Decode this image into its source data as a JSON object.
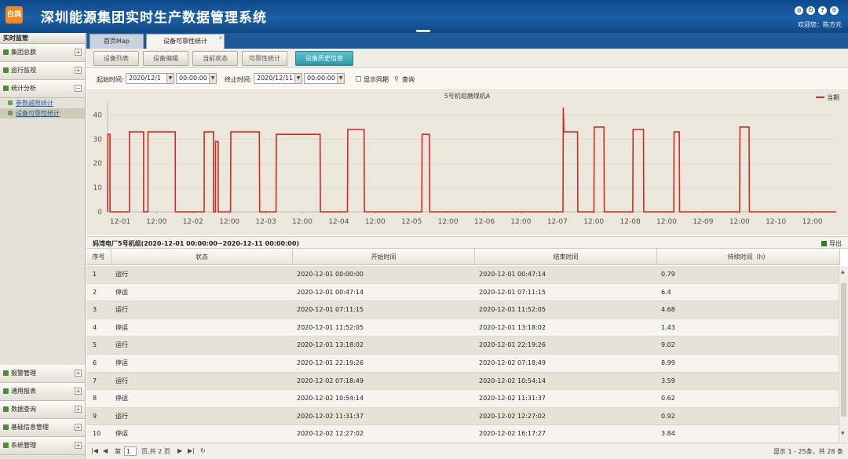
{
  "header": {
    "logo_text": "白鸽",
    "title": "深圳能源集团实时生产数据管理系统",
    "welcome": "欢迎您：陈方元",
    "icons": [
      "globe-icon",
      "power-icon",
      "help-icon",
      "settings-icon"
    ]
  },
  "sidebar": {
    "title": "实时监管",
    "top_sections": [
      {
        "label": "集团总貌",
        "toggle": "+"
      },
      {
        "label": "运行监视",
        "toggle": "+"
      },
      {
        "label": "统计分析",
        "toggle": "−"
      }
    ],
    "sub_items": [
      {
        "label": "参数越限统计"
      },
      {
        "label": "设备可靠性统计"
      }
    ],
    "bottom_sections": [
      {
        "label": "报警管理",
        "toggle": "+"
      },
      {
        "label": "通用报表",
        "toggle": "+"
      },
      {
        "label": "数据查询",
        "toggle": "+"
      },
      {
        "label": "基础信息管理",
        "toggle": "+"
      },
      {
        "label": "系统管理",
        "toggle": "+"
      }
    ]
  },
  "tabs": {
    "map": "首页Map",
    "stat": "设备可靠性统计",
    "close": "x"
  },
  "subtabs": [
    "设备列表",
    "设备编辑",
    "当前状态",
    "可靠性统计",
    "设备历史信息"
  ],
  "filter": {
    "start_label": "起始时间:",
    "start_date": "2020/12/1",
    "start_time": "00:00:00",
    "end_label": "终止时间:",
    "end_date": "2020/12/11",
    "end_time": "00:00:00",
    "show_sync": "显示同期",
    "query": "查询"
  },
  "chart_data": {
    "type": "line",
    "title": "5号机组磨煤机A",
    "legend": "当期",
    "color": "#d22b1f",
    "ylim": [
      0,
      45
    ],
    "yticks": [
      0,
      10,
      20,
      30,
      40
    ],
    "xticks": [
      "12-01",
      "12:00",
      "12-02",
      "12:00",
      "12-03",
      "12:00",
      "12-04",
      "12:00",
      "12-05",
      "12:00",
      "12-06",
      "12:00",
      "12-07",
      "12:00",
      "12-08",
      "12:00",
      "12-09",
      "12:00",
      "12-10",
      "12:00"
    ],
    "xlim_hours": [
      0,
      240
    ],
    "points": [
      [
        0,
        0
      ],
      [
        0.1,
        32
      ],
      [
        0.79,
        32
      ],
      [
        0.8,
        0
      ],
      [
        7.19,
        0
      ],
      [
        7.2,
        33
      ],
      [
        11.86,
        33
      ],
      [
        11.87,
        0
      ],
      [
        13.3,
        0
      ],
      [
        13.31,
        33
      ],
      [
        22.3,
        33
      ],
      [
        22.32,
        0
      ],
      [
        31.8,
        0
      ],
      [
        31.83,
        33
      ],
      [
        34.9,
        33
      ],
      [
        34.9,
        0
      ],
      [
        35.53,
        0
      ],
      [
        35.55,
        29
      ],
      [
        36.44,
        29
      ],
      [
        36.45,
        0
      ],
      [
        40.5,
        0
      ],
      [
        40.6,
        33
      ],
      [
        50,
        33
      ],
      [
        50.1,
        0
      ],
      [
        55.5,
        0
      ],
      [
        55.6,
        32
      ],
      [
        70,
        32
      ],
      [
        70.1,
        0
      ],
      [
        79,
        0
      ],
      [
        79.1,
        34
      ],
      [
        84.5,
        34
      ],
      [
        84.6,
        0
      ],
      [
        103.5,
        0
      ],
      [
        103.6,
        32
      ],
      [
        106,
        32
      ],
      [
        106.1,
        0
      ],
      [
        150,
        0
      ],
      [
        150.1,
        43
      ],
      [
        150.3,
        33
      ],
      [
        154.8,
        33
      ],
      [
        154.9,
        0
      ],
      [
        160.2,
        0
      ],
      [
        160.3,
        35
      ],
      [
        163.5,
        35
      ],
      [
        163.6,
        0
      ],
      [
        173,
        0
      ],
      [
        173.1,
        34
      ],
      [
        176.5,
        34
      ],
      [
        176.6,
        0
      ],
      [
        186.5,
        0
      ],
      [
        186.6,
        33
      ],
      [
        188.3,
        33
      ],
      [
        188.4,
        0
      ],
      [
        208.2,
        0
      ],
      [
        208.3,
        35
      ],
      [
        211.3,
        35
      ],
      [
        211.4,
        0
      ],
      [
        240,
        0
      ]
    ]
  },
  "grid": {
    "title": "妈湾电厂5号机组(2020-12-01 00:00:00~2020-12-11 00:00:00)",
    "export": "导出",
    "columns": [
      "序号",
      "状态",
      "开始时间",
      "结束时间",
      "持续时间（h）"
    ],
    "rows": [
      [
        "1",
        "运行",
        "2020-12-01 00:00:00",
        "2020-12-01 00:47:14",
        "0.79"
      ],
      [
        "2",
        "停运",
        "2020-12-01 00:47:14",
        "2020-12-01 07:11:15",
        "6.4"
      ],
      [
        "3",
        "运行",
        "2020-12-01 07:11:15",
        "2020-12-01 11:52:05",
        "4.68"
      ],
      [
        "4",
        "停运",
        "2020-12-01 11:52:05",
        "2020-12-01 13:18:02",
        "1.43"
      ],
      [
        "5",
        "运行",
        "2020-12-01 13:18:02",
        "2020-12-01 22:19:26",
        "9.02"
      ],
      [
        "6",
        "停运",
        "2020-12-01 22:19:26",
        "2020-12-02 07:18:49",
        "8.99"
      ],
      [
        "7",
        "运行",
        "2020-12-02 07:18:49",
        "2020-12-02 10:54:14",
        "3.59"
      ],
      [
        "8",
        "停运",
        "2020-12-02 10:54:14",
        "2020-12-02 11:31:37",
        "0.62"
      ],
      [
        "9",
        "运行",
        "2020-12-02 11:31:37",
        "2020-12-02 12:27:02",
        "0.92"
      ],
      [
        "10",
        "停运",
        "2020-12-02 12:27:02",
        "2020-12-02 16:17:27",
        "3.84"
      ]
    ]
  },
  "pager": {
    "page_label": "第",
    "page": "1",
    "total_pages": "页,共 2 页",
    "info": "显示 1 - 25条，共 28 条"
  }
}
